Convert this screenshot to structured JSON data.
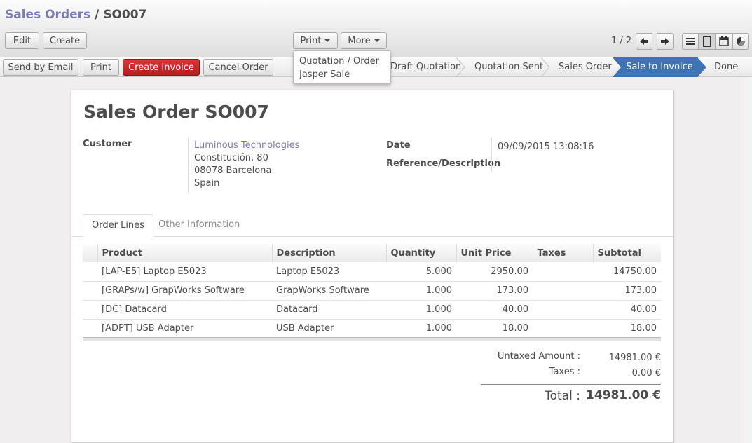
{
  "breadcrumb": {
    "parent": "Sales Orders",
    "separator": " / ",
    "current": "SO007"
  },
  "toolbar": {
    "edit_label": "Edit",
    "create_label": "Create",
    "print_label": "Print",
    "more_label": "More"
  },
  "pager": {
    "text": "1 / 2"
  },
  "view_icons": [
    "list-view-icon",
    "form-view-icon",
    "calendar-view-icon",
    "graph-view-icon"
  ],
  "print_menu": {
    "items": [
      "Quotation / Order",
      "Jasper Sale"
    ]
  },
  "actions": {
    "send_email": "Send by Email",
    "print": "Print",
    "create_invoice": "Create Invoice",
    "cancel_order": "Cancel Order"
  },
  "status": {
    "stages": [
      "Draft Quotation",
      "Quotation Sent",
      "Sales Order",
      "Sale to Invoice",
      "Done"
    ],
    "active": "Sale to Invoice",
    "active_color": "#3e73b4"
  },
  "sheet": {
    "title": "Sales Order SO007",
    "customer_label": "Customer",
    "customer_name": "Luminous Technologies",
    "address_line1": "Constitución, 80",
    "address_line2": "08078 Barcelona",
    "address_line3": "Spain",
    "date_label": "Date",
    "date_value": "09/09/2015 13:08:16",
    "reference_label": "Reference/Description"
  },
  "tabs": {
    "order_lines": "Order Lines",
    "other_info": "Other Information"
  },
  "order_lines": {
    "headers": [
      "Product",
      "Description",
      "Quantity",
      "Unit Price",
      "Taxes",
      "Subtotal"
    ],
    "rows": [
      {
        "product": "[LAP-E5] Laptop E5023",
        "description": "Laptop E5023",
        "quantity": "5.000",
        "unit_price": "2950.00",
        "taxes": "",
        "subtotal": "14750.00"
      },
      {
        "product": "[GRAPs/w] GrapWorks Software",
        "description": "GrapWorks Software",
        "quantity": "1.000",
        "unit_price": "173.00",
        "taxes": "",
        "subtotal": "173.00"
      },
      {
        "product": "[DC] Datacard",
        "description": "Datacard",
        "quantity": "1.000",
        "unit_price": "40.00",
        "taxes": "",
        "subtotal": "40.00"
      },
      {
        "product": "[ADPT] USB Adapter",
        "description": "USB Adapter",
        "quantity": "1.000",
        "unit_price": "18.00",
        "taxes": "",
        "subtotal": "18.00"
      }
    ]
  },
  "totals": {
    "untaxed_label": "Untaxed Amount :",
    "untaxed_value": "14981.00 €",
    "taxes_label": "Taxes :",
    "taxes_value": "0.00 €",
    "total_label": "Total :",
    "total_value": "14981.00 €"
  },
  "colors": {
    "link": "#7c7bad",
    "create_invoice": "#c62828",
    "active_stage": "#3e73b4"
  }
}
